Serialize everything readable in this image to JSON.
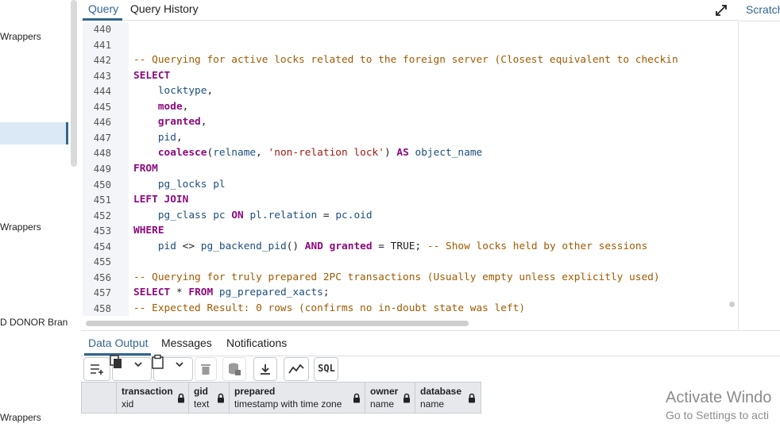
{
  "tree": {
    "items": [
      {
        "label": "Wrappers"
      },
      {
        "label": "Wrappers"
      },
      {
        "label": "D DONOR Bran"
      },
      {
        "label": "Wrappers"
      }
    ]
  },
  "editor": {
    "tabs": [
      {
        "label": "Query"
      },
      {
        "label": "Query History"
      }
    ],
    "expand_icon": "expand-icon",
    "line_numbers": [
      "440",
      "441",
      "442",
      "443",
      "444",
      "445",
      "446",
      "447",
      "448",
      "449",
      "450",
      "451",
      "452",
      "453",
      "454",
      "455",
      "456",
      "457",
      "458"
    ],
    "lines": [
      [],
      [],
      [
        {
          "t": "-- Querying for active locks related to the foreign server (Closest equivalent to checkin",
          "c": "cmt"
        }
      ],
      [
        {
          "t": "SELECT",
          "c": "kw"
        }
      ],
      [
        {
          "t": "    "
        },
        {
          "t": "locktype",
          "c": "id"
        },
        {
          "t": ","
        }
      ],
      [
        {
          "t": "    "
        },
        {
          "t": "mode",
          "c": "kw"
        },
        {
          "t": ","
        }
      ],
      [
        {
          "t": "    "
        },
        {
          "t": "granted",
          "c": "kw"
        },
        {
          "t": ","
        }
      ],
      [
        {
          "t": "    "
        },
        {
          "t": "pid",
          "c": "id"
        },
        {
          "t": ","
        }
      ],
      [
        {
          "t": "    "
        },
        {
          "t": "coalesce",
          "c": "kw"
        },
        {
          "t": "("
        },
        {
          "t": "relname",
          "c": "id"
        },
        {
          "t": ", "
        },
        {
          "t": "'non-relation lock'",
          "c": "str"
        },
        {
          "t": ") "
        },
        {
          "t": "AS",
          "c": "kw"
        },
        {
          "t": " "
        },
        {
          "t": "object_name",
          "c": "id"
        }
      ],
      [
        {
          "t": "FROM",
          "c": "kw"
        }
      ],
      [
        {
          "t": "    "
        },
        {
          "t": "pg_locks",
          "c": "id"
        },
        {
          "t": " "
        },
        {
          "t": "pl",
          "c": "id"
        }
      ],
      [
        {
          "t": "LEFT JOIN",
          "c": "kw"
        }
      ],
      [
        {
          "t": "    "
        },
        {
          "t": "pg_class",
          "c": "id"
        },
        {
          "t": " "
        },
        {
          "t": "pc",
          "c": "id"
        },
        {
          "t": " "
        },
        {
          "t": "ON",
          "c": "kw"
        },
        {
          "t": " "
        },
        {
          "t": "pl.relation",
          "c": "id"
        },
        {
          "t": " = "
        },
        {
          "t": "pc.oid",
          "c": "id"
        }
      ],
      [
        {
          "t": "WHERE",
          "c": "kw"
        }
      ],
      [
        {
          "t": "    "
        },
        {
          "t": "pid",
          "c": "id"
        },
        {
          "t": " <> "
        },
        {
          "t": "pg_backend_pid",
          "c": "id"
        },
        {
          "t": "() "
        },
        {
          "t": "AND",
          "c": "kw"
        },
        {
          "t": " "
        },
        {
          "t": "granted",
          "c": "kw"
        },
        {
          "t": " = TRUE; "
        },
        {
          "t": "-- Show locks held by other sessions",
          "c": "cmt"
        }
      ],
      [],
      [
        {
          "t": "-- Querying for truly prepared 2PC transactions (Usually empty unless explicitly used)",
          "c": "cmt"
        }
      ],
      [
        {
          "t": "SELECT",
          "c": "kw"
        },
        {
          "t": " * "
        },
        {
          "t": "FROM",
          "c": "kw"
        },
        {
          "t": " "
        },
        {
          "t": "pg_prepared_xacts",
          "c": "id"
        },
        {
          "t": ";"
        }
      ],
      [
        {
          "t": "-- Expected Result: 0 rows (confirms no in-doubt state was left)",
          "c": "cmt"
        }
      ]
    ]
  },
  "scratch": {
    "tab_label": "Scratch"
  },
  "results": {
    "tabs": [
      {
        "label": "Data Output"
      },
      {
        "label": "Messages"
      },
      {
        "label": "Notifications"
      }
    ],
    "toolbar": {
      "buttons": [
        "add-row-icon",
        "copy-icon",
        "dropdown-icon",
        "paste-icon",
        "dropdown-icon",
        "delete-icon",
        "save-data-icon",
        "download-icon",
        "graph-icon",
        "sql-icon"
      ],
      "sql_label": "SQL"
    },
    "columns": [
      {
        "name": "transaction",
        "type": "xid"
      },
      {
        "name": "gid",
        "type": "text"
      },
      {
        "name": "prepared",
        "type": "timestamp with time zone"
      },
      {
        "name": "owner",
        "type": "name"
      },
      {
        "name": "database",
        "type": "name"
      }
    ],
    "rows": []
  },
  "watermark": {
    "title": "Activate Windo",
    "subtitle": "Go to Settings to acti"
  },
  "colors": {
    "accent": "#326690",
    "keyword": "#8d0a7e",
    "identifier": "#1c4e7e",
    "string": "#a11a14",
    "comment": "#a05a00"
  }
}
